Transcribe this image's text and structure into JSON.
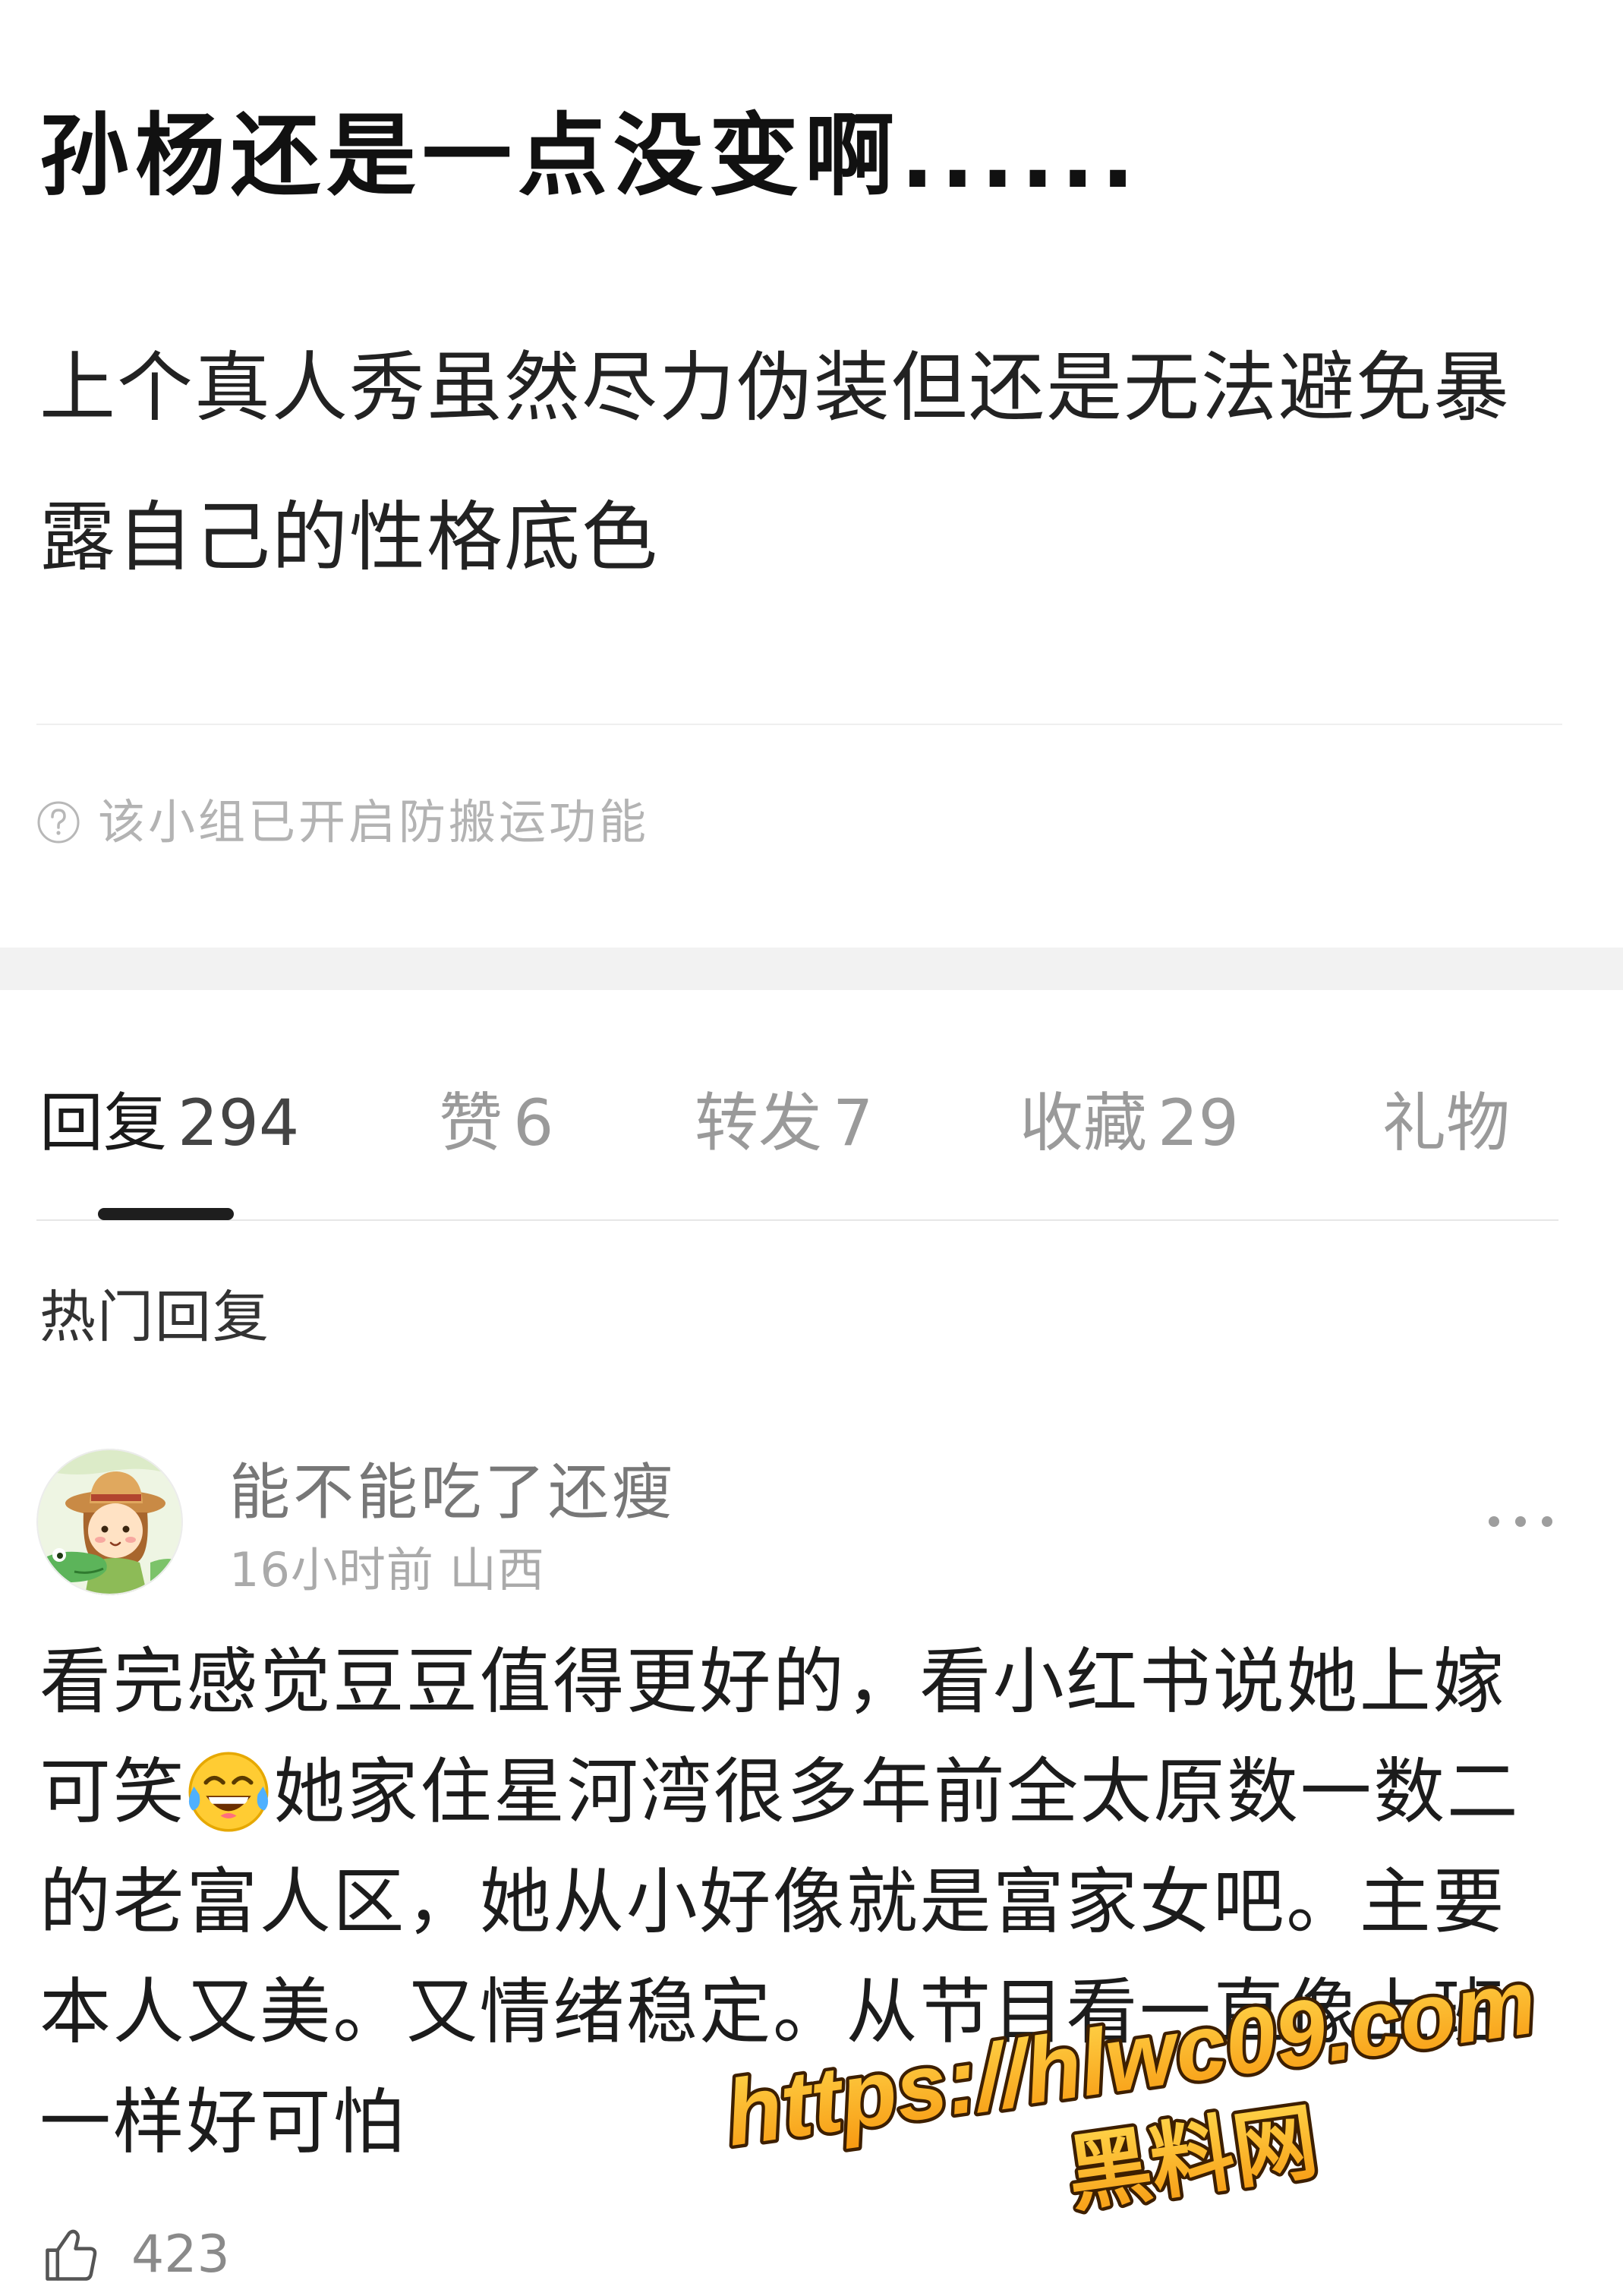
{
  "post": {
    "title": "孙杨还是一点没变啊......",
    "body_lines": [
      "上个真人秀虽然尽力伪装但还是无法避免暴",
      "露自己的性格底色"
    ],
    "notice": {
      "icon": "question-circle-icon",
      "text": "该小组已开启防搬运功能"
    }
  },
  "tabs": [
    {
      "label": "回复",
      "count": "294",
      "active": true
    },
    {
      "label": "赞",
      "count": "6",
      "active": false
    },
    {
      "label": "转发",
      "count": "7",
      "active": false
    },
    {
      "label": "收藏",
      "count": "29",
      "active": false
    },
    {
      "label": "礼物",
      "active": false
    }
  ],
  "hot_replies": {
    "heading": "热门回复",
    "comment": {
      "author": "能不能吃了还瘦",
      "time": "16小时前",
      "location": "山西",
      "more_icon": "more-dots-icon",
      "lines": [
        {
          "text": "看完感觉豆豆值得更好的，看小红书说她上嫁"
        },
        {
          "text_before": "可笑",
          "emoji": "face-with-tears-of-joy-icon",
          "text_after": "她家住星河湾很多年前全太原数一数二"
        },
        {
          "text": "的老富人区，她从小好像就是富家女吧。主要"
        },
        {
          "text": "本人又美。又情绪稳定。从节目看一直像上班"
        },
        {
          "text": "一样好可怕"
        }
      ],
      "likes": {
        "icon": "thumbs-up-icon",
        "count": "423"
      }
    }
  },
  "watermark": {
    "url": "https://hlwc09.com",
    "name": "黑料网"
  },
  "colors": {
    "text_primary": "#1c1c1c",
    "text_secondary": "#9a9a9a",
    "tab_indicator": "#1e1e1e",
    "section_band": "#f2f2f2",
    "watermark_fill": "#f79a12",
    "watermark_stroke": "#3d1f00"
  }
}
